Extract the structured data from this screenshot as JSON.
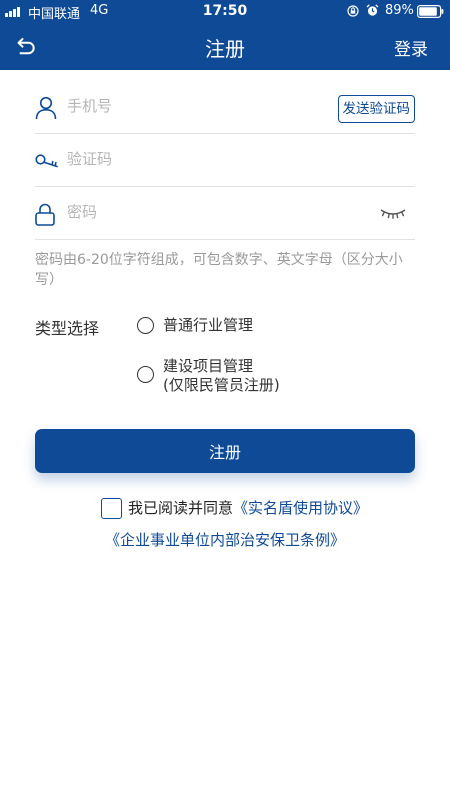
{
  "status_bar": {
    "carrier": "中国联通",
    "network": "4G",
    "time": "17:50",
    "battery": "89%"
  },
  "nav": {
    "title": "注册",
    "login": "登录"
  },
  "form": {
    "phone_placeholder": "手机号",
    "send_code": "发送验证码",
    "code_placeholder": "验证码",
    "password_placeholder": "密码",
    "password_hint": "密码由6-20位字符组成，可包含数字、英文字母（区分大小写）"
  },
  "type_select": {
    "label": "类型选择",
    "options": [
      {
        "label": "普通行业管理",
        "selected": false
      },
      {
        "label": "建设项目管理",
        "sub": "(仅限民管员注册)",
        "selected": false
      }
    ]
  },
  "register_button": "注册",
  "agreement": {
    "checked": false,
    "prefix": "我已阅读并同意",
    "link1": "《实名盾使用协议》",
    "link2": "《企业事业单位内部治安保卫条例》"
  },
  "colors": {
    "primary": "#0f4a96",
    "hint_text": "#9a9a9a",
    "placeholder": "#b5b5b5",
    "divider": "#e2e2e2"
  },
  "icons": [
    "signal-icon",
    "alarm-icon",
    "rotation-lock-icon",
    "battery-icon",
    "back-icon",
    "user-icon",
    "key-icon",
    "lock-icon",
    "eye-closed-icon"
  ]
}
